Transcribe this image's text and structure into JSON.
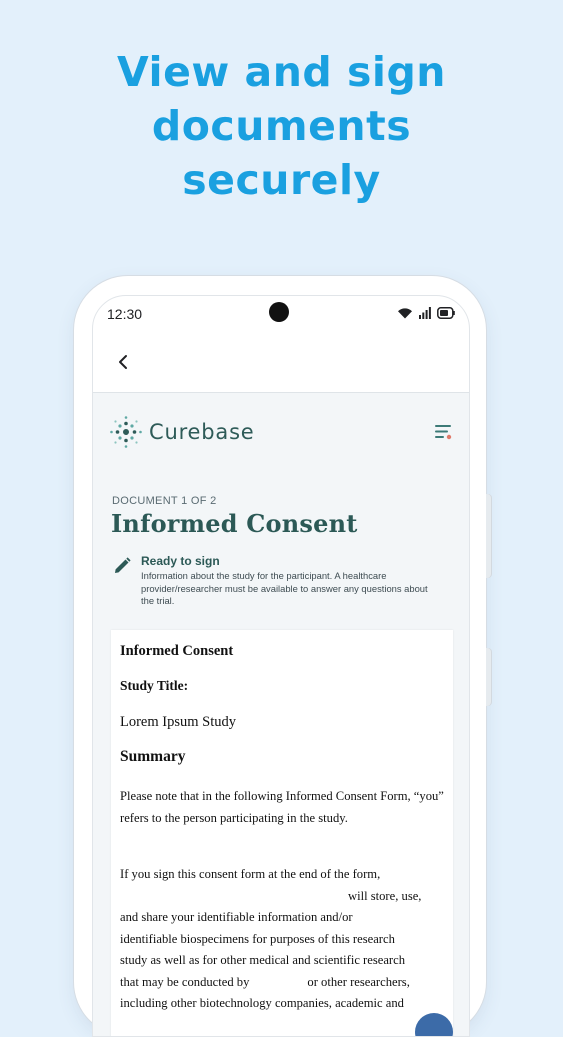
{
  "headline": {
    "line1": "View and sign",
    "line2": "documents",
    "line3": "securely"
  },
  "status_bar": {
    "time": "12:30",
    "icons": [
      "wifi-icon",
      "signal-icon",
      "battery-icon"
    ]
  },
  "app_bar": {
    "back_icon": "chevron-left-icon"
  },
  "brand": {
    "name": "Curebase",
    "logo_icon": "curebase-dots-logo",
    "menu_icon": "filter-menu-icon"
  },
  "document": {
    "counter": "DOCUMENT 1 OF 2",
    "title": "Informed Consent",
    "status_icon": "pencil-icon",
    "status_label": "Ready to sign",
    "status_description": "Information about the study for the participant. A healthcare provider/researcher must be available to answer any questions about the trial."
  },
  "doc_body": {
    "heading": "Informed Consent",
    "study_title_label": "Study Title:",
    "study_title_value": "Lorem Ipsum Study",
    "summary_heading": "Summary",
    "paragraph1": "Please note that in the following Informed Consent Form, “you” refers to the person participating in the study.",
    "paragraph2_line1": "If you sign this consent form at the end of the form,",
    "paragraph2_line2": "will store, use,",
    "paragraph2_line3": "and share your identifiable information and/or",
    "paragraph2_line4": "identifiable biospecimens for purposes of this research",
    "paragraph2_line5": "study as well as for other medical and scientific research",
    "paragraph2_line6a": "that may be conducted by",
    "paragraph2_line6b": "or other researchers,",
    "paragraph2_line7": "including other biotechnology companies, academic and"
  },
  "colors": {
    "headline": "#1aa0e0",
    "brand": "#2e5b58",
    "background": "#e3f0fb",
    "fab": "#3c6ba8"
  }
}
